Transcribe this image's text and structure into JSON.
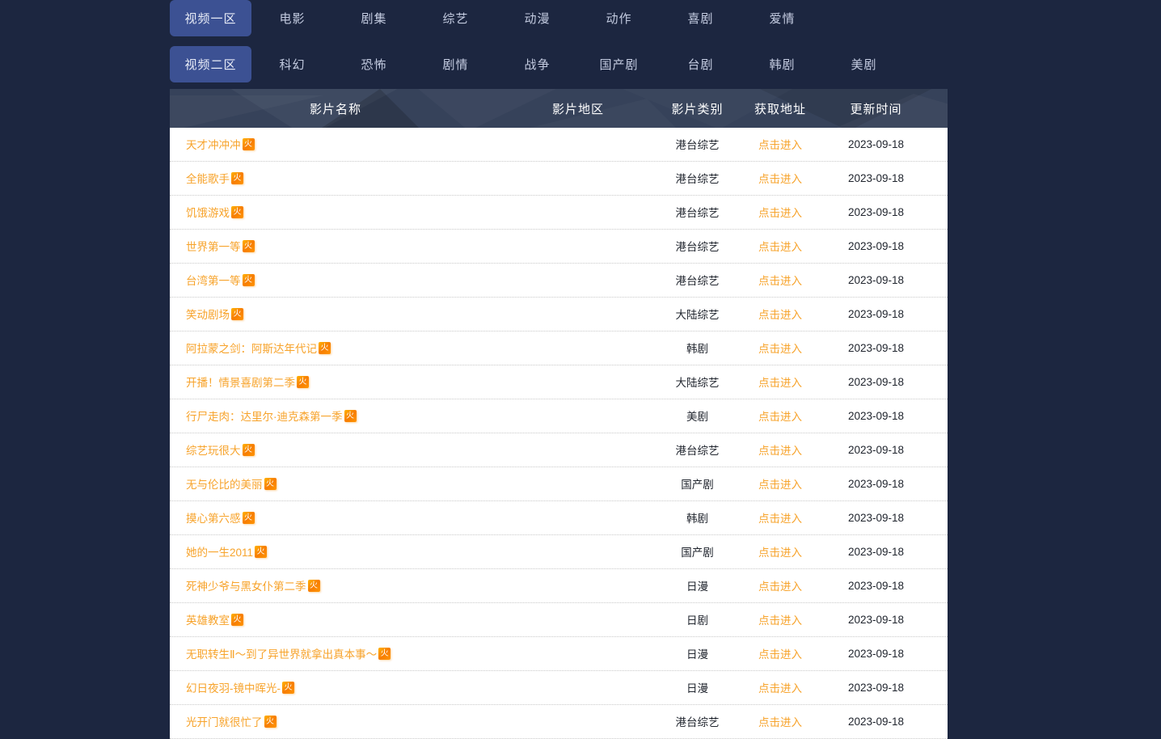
{
  "nav": {
    "rows": [
      {
        "tab": {
          "label": "视频一区",
          "active": true
        },
        "items": [
          "电影",
          "剧集",
          "综艺",
          "动漫",
          "动作",
          "喜剧",
          "爱情"
        ]
      },
      {
        "tab": {
          "label": "视频二区",
          "active": true
        },
        "items": [
          "科幻",
          "恐怖",
          "剧情",
          "战争",
          "国产剧",
          "台剧",
          "韩剧",
          "美剧"
        ]
      }
    ]
  },
  "colors": {
    "page_background": "#1c2640",
    "tab_active": "#3c5193",
    "table_header": "#36425a",
    "accent_orange": "#f7a32b",
    "badge_orange": "#f77d00"
  },
  "table": {
    "columns": [
      "影片名称",
      "影片地区",
      "影片类别",
      "获取地址",
      "更新时间"
    ],
    "badge_label": "火",
    "enter_label": "点击进入",
    "rows": [
      {
        "name": "天才冲冲冲",
        "region": "",
        "category": "港台综艺",
        "link": "点击进入",
        "time": "2023-09-18"
      },
      {
        "name": "全能歌手",
        "region": "",
        "category": "港台综艺",
        "link": "点击进入",
        "time": "2023-09-18"
      },
      {
        "name": "饥饿游戏",
        "region": "",
        "category": "港台综艺",
        "link": "点击进入",
        "time": "2023-09-18"
      },
      {
        "name": "世界第一等",
        "region": "",
        "category": "港台综艺",
        "link": "点击进入",
        "time": "2023-09-18"
      },
      {
        "name": "台湾第一等",
        "region": "",
        "category": "港台综艺",
        "link": "点击进入",
        "time": "2023-09-18"
      },
      {
        "name": "笑动剧场",
        "region": "",
        "category": "大陆综艺",
        "link": "点击进入",
        "time": "2023-09-18"
      },
      {
        "name": "阿拉蒙之剑：阿斯达年代记",
        "region": "",
        "category": "韩剧",
        "link": "点击进入",
        "time": "2023-09-18"
      },
      {
        "name": "开播！情景喜剧第二季",
        "region": "",
        "category": "大陆综艺",
        "link": "点击进入",
        "time": "2023-09-18"
      },
      {
        "name": "行尸走肉：达里尔·迪克森第一季",
        "region": "",
        "category": "美剧",
        "link": "点击进入",
        "time": "2023-09-18"
      },
      {
        "name": "综艺玩很大",
        "region": "",
        "category": "港台综艺",
        "link": "点击进入",
        "time": "2023-09-18"
      },
      {
        "name": "无与伦比的美丽",
        "region": "",
        "category": "国产剧",
        "link": "点击进入",
        "time": "2023-09-18"
      },
      {
        "name": "摸心第六感",
        "region": "",
        "category": "韩剧",
        "link": "点击进入",
        "time": "2023-09-18"
      },
      {
        "name": "她的一生2011",
        "region": "",
        "category": "国产剧",
        "link": "点击进入",
        "time": "2023-09-18"
      },
      {
        "name": "死神少爷与黑女仆第二季",
        "region": "",
        "category": "日漫",
        "link": "点击进入",
        "time": "2023-09-18"
      },
      {
        "name": "英雄教室",
        "region": "",
        "category": "日剧",
        "link": "点击进入",
        "time": "2023-09-18"
      },
      {
        "name": "无职转生Ⅱ～到了异世界就拿出真本事～",
        "region": "",
        "category": "日漫",
        "link": "点击进入",
        "time": "2023-09-18"
      },
      {
        "name": "幻日夜羽-镜中晖光-",
        "region": "",
        "category": "日漫",
        "link": "点击进入",
        "time": "2023-09-18"
      },
      {
        "name": "光开门就很忙了",
        "region": "",
        "category": "港台综艺",
        "link": "点击进入",
        "time": "2023-09-18"
      }
    ]
  }
}
